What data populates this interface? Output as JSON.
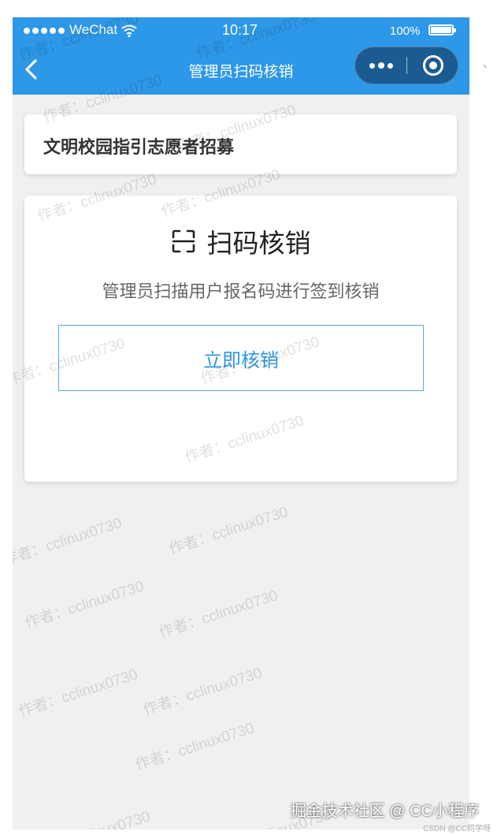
{
  "status_bar": {
    "carrier": "WeChat",
    "time": "10:17",
    "battery": "100%",
    "battery_level": 1.0
  },
  "nav": {
    "title": "管理员扫码核销",
    "back_icon": "chevron-left-icon",
    "more_icon": "more-dots-icon",
    "close_icon": "target-close-icon"
  },
  "activity": {
    "title": "文明校园指引志愿者招募"
  },
  "scan": {
    "icon": "scan-icon",
    "title": "扫码核销",
    "description": "管理员扫描用户报名码进行签到核销",
    "button_label": "立即核销"
  },
  "colors": {
    "nav_bg": "#2d97e8",
    "capsule_bg": "#1b5b91",
    "page_bg": "#f0f0f0",
    "button_text": "#2d97e8"
  },
  "watermark": "作者：cclinux0730",
  "footer": {
    "brand": "掘金技术社区 @ CC小程序",
    "credit": "CSDN @CC同学呀"
  },
  "edge_mark": "、"
}
